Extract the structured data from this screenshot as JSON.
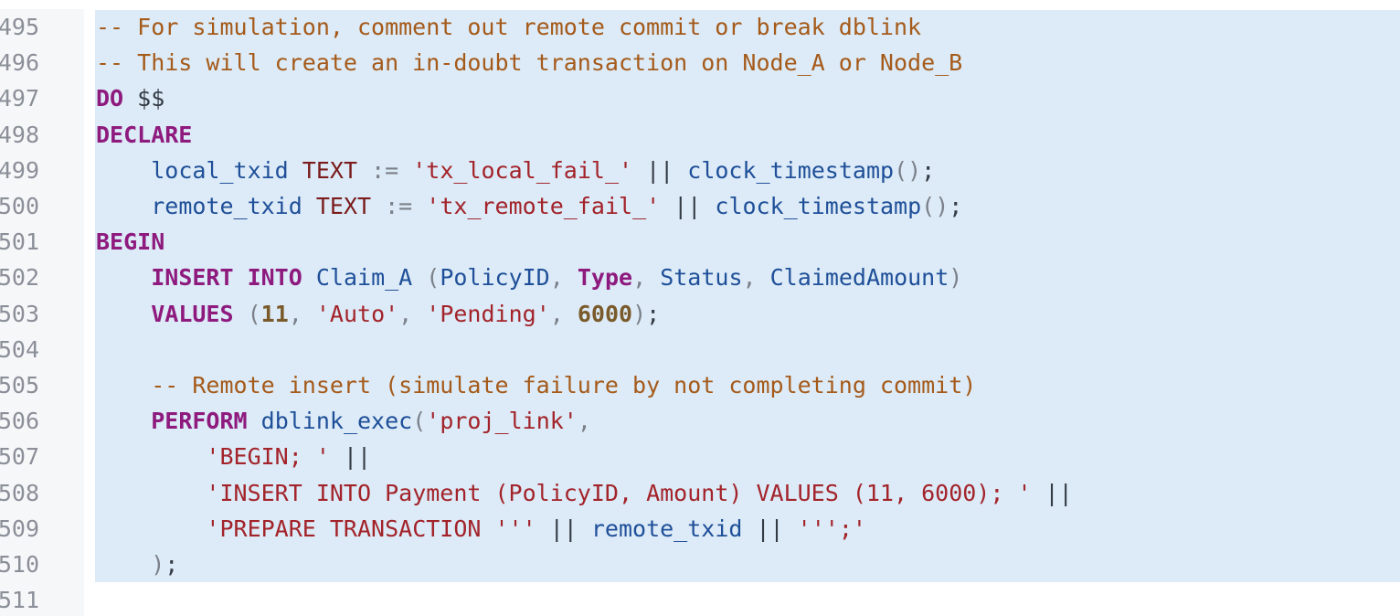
{
  "editor": {
    "lines": [
      {
        "number": "495",
        "tokens": [
          {
            "t": "-- For simulation, comment out remote commit or break dblink",
            "c": "cm"
          }
        ]
      },
      {
        "number": "496",
        "tokens": [
          {
            "t": "-- This will create an in-doubt transaction on Node_A or Node_B",
            "c": "cm"
          }
        ]
      },
      {
        "number": "497",
        "tokens": [
          {
            "t": "DO",
            "c": "kw"
          },
          {
            "t": " $$",
            "c": "p"
          }
        ]
      },
      {
        "number": "498",
        "tokens": [
          {
            "t": "DECLARE",
            "c": "kw"
          }
        ]
      },
      {
        "number": "499",
        "tokens": [
          {
            "t": "    ",
            "c": "p"
          },
          {
            "t": "local_txid",
            "c": "id"
          },
          {
            "t": " ",
            "c": "p"
          },
          {
            "t": "TEXT",
            "c": "ty"
          },
          {
            "t": " := ",
            "c": "punc"
          },
          {
            "t": "'tx_local_fail_'",
            "c": "str"
          },
          {
            "t": " || ",
            "c": "p"
          },
          {
            "t": "clock_timestamp",
            "c": "id"
          },
          {
            "t": "()",
            "c": "punc"
          },
          {
            "t": ";",
            "c": "p"
          }
        ]
      },
      {
        "number": "500",
        "tokens": [
          {
            "t": "    ",
            "c": "p"
          },
          {
            "t": "remote_txid",
            "c": "id"
          },
          {
            "t": " ",
            "c": "p"
          },
          {
            "t": "TEXT",
            "c": "ty"
          },
          {
            "t": " := ",
            "c": "punc"
          },
          {
            "t": "'tx_remote_fail_'",
            "c": "str"
          },
          {
            "t": " || ",
            "c": "p"
          },
          {
            "t": "clock_timestamp",
            "c": "id"
          },
          {
            "t": "()",
            "c": "punc"
          },
          {
            "t": ";",
            "c": "p"
          }
        ]
      },
      {
        "number": "501",
        "tokens": [
          {
            "t": "BEGIN",
            "c": "kw"
          }
        ]
      },
      {
        "number": "502",
        "tokens": [
          {
            "t": "    ",
            "c": "p"
          },
          {
            "t": "INSERT INTO",
            "c": "kw"
          },
          {
            "t": " ",
            "c": "p"
          },
          {
            "t": "Claim_A",
            "c": "id"
          },
          {
            "t": " (",
            "c": "punc"
          },
          {
            "t": "PolicyID",
            "c": "id"
          },
          {
            "t": ", ",
            "c": "punc"
          },
          {
            "t": "Type",
            "c": "kw"
          },
          {
            "t": ", ",
            "c": "punc"
          },
          {
            "t": "Status",
            "c": "id"
          },
          {
            "t": ", ",
            "c": "punc"
          },
          {
            "t": "ClaimedAmount",
            "c": "id"
          },
          {
            "t": ")",
            "c": "punc"
          }
        ]
      },
      {
        "number": "503",
        "tokens": [
          {
            "t": "    ",
            "c": "p"
          },
          {
            "t": "VALUES",
            "c": "kw"
          },
          {
            "t": " (",
            "c": "punc"
          },
          {
            "t": "11",
            "c": "num"
          },
          {
            "t": ", ",
            "c": "punc"
          },
          {
            "t": "'Auto'",
            "c": "str"
          },
          {
            "t": ", ",
            "c": "punc"
          },
          {
            "t": "'Pending'",
            "c": "str"
          },
          {
            "t": ", ",
            "c": "punc"
          },
          {
            "t": "6000",
            "c": "num"
          },
          {
            "t": ")",
            "c": "punc"
          },
          {
            "t": ";",
            "c": "p"
          }
        ]
      },
      {
        "number": "504",
        "tokens": []
      },
      {
        "number": "505",
        "tokens": [
          {
            "t": "    ",
            "c": "p"
          },
          {
            "t": "-- Remote insert (simulate failure by not completing commit)",
            "c": "cm"
          }
        ]
      },
      {
        "number": "506",
        "tokens": [
          {
            "t": "    ",
            "c": "p"
          },
          {
            "t": "PERFORM",
            "c": "kw"
          },
          {
            "t": " ",
            "c": "p"
          },
          {
            "t": "dblink_exec",
            "c": "id"
          },
          {
            "t": "(",
            "c": "punc"
          },
          {
            "t": "'proj_link'",
            "c": "str"
          },
          {
            "t": ",",
            "c": "punc"
          }
        ]
      },
      {
        "number": "507",
        "tokens": [
          {
            "t": "        ",
            "c": "p"
          },
          {
            "t": "'BEGIN; '",
            "c": "str"
          },
          {
            "t": " ||",
            "c": "p"
          }
        ]
      },
      {
        "number": "508",
        "tokens": [
          {
            "t": "        ",
            "c": "p"
          },
          {
            "t": "'INSERT INTO Payment (PolicyID, Amount) VALUES (11, 6000); '",
            "c": "str"
          },
          {
            "t": " ||",
            "c": "p"
          }
        ]
      },
      {
        "number": "509",
        "tokens": [
          {
            "t": "        ",
            "c": "p"
          },
          {
            "t": "'PREPARE TRANSACTION '''",
            "c": "str"
          },
          {
            "t": " || ",
            "c": "p"
          },
          {
            "t": "remote_txid",
            "c": "id"
          },
          {
            "t": " || ",
            "c": "p"
          },
          {
            "t": "''';'",
            "c": "str"
          }
        ]
      },
      {
        "number": "510",
        "tokens": [
          {
            "t": "    ",
            "c": "p"
          },
          {
            "t": ")",
            "c": "punc"
          },
          {
            "t": ";",
            "c": "p"
          }
        ]
      },
      {
        "number": "511",
        "tokens": []
      }
    ]
  }
}
